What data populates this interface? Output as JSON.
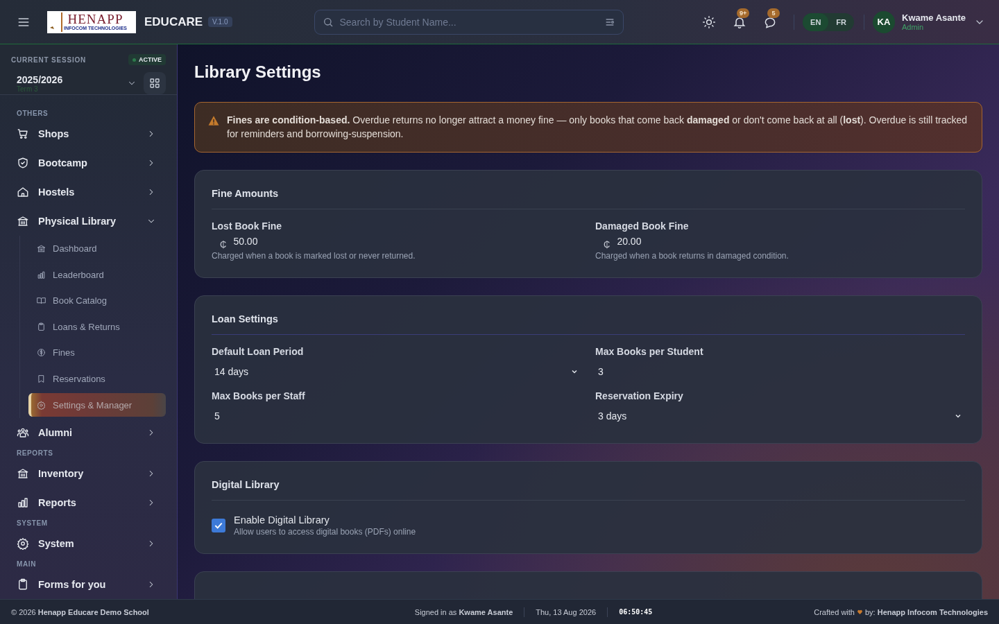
{
  "header": {
    "logo": {
      "line1": "HENAPP",
      "line2": "INFOCOM TECHNOLOGIES"
    },
    "app_name": "EDUCARE",
    "version": "V.1.0",
    "search": {
      "placeholder": "Search by Student Name..."
    },
    "notifications_badge": "9+",
    "messages_badge": "5",
    "languages": [
      {
        "label": "EN",
        "selected": true
      },
      {
        "label": "FR",
        "selected": false
      }
    ],
    "user": {
      "initials": "KA",
      "name": "Kwame Asante",
      "role": "Admin"
    }
  },
  "session": {
    "label": "CURRENT SESSION",
    "status": "ACTIVE",
    "year": "2025/2026",
    "term": "Term 3"
  },
  "sidebar": {
    "items": [
      {
        "kind": "section",
        "label": "OTHERS"
      },
      {
        "kind": "item",
        "label": "Shops",
        "expanded": false
      },
      {
        "kind": "item",
        "label": "Bootcamp",
        "expanded": false
      },
      {
        "kind": "item",
        "label": "Hostels",
        "expanded": false
      },
      {
        "kind": "item",
        "label": "Physical Library",
        "expanded": true,
        "children": [
          {
            "label": "Dashboard",
            "selected": false
          },
          {
            "label": "Leaderboard",
            "selected": false
          },
          {
            "label": "Book Catalog",
            "selected": false
          },
          {
            "label": "Loans & Returns",
            "selected": false
          },
          {
            "label": "Fines",
            "selected": false
          },
          {
            "label": "Reservations",
            "selected": false
          },
          {
            "label": "Settings & Manager",
            "selected": true
          }
        ]
      },
      {
        "kind": "item",
        "label": "Alumni",
        "expanded": false
      },
      {
        "kind": "section",
        "label": "REPORTS"
      },
      {
        "kind": "item",
        "label": "Inventory",
        "expanded": false
      },
      {
        "kind": "item",
        "label": "Reports",
        "expanded": false
      },
      {
        "kind": "section",
        "label": "SYSTEM"
      },
      {
        "kind": "item",
        "label": "System",
        "expanded": false
      },
      {
        "kind": "section",
        "label": "MAIN"
      },
      {
        "kind": "item",
        "label": "Forms for you",
        "expanded": false
      }
    ]
  },
  "page": {
    "title": "Library Settings",
    "alert": "**Fines are condition-based.** Overdue returns no longer attract a money fine — only books that come back **damaged** or don't come back at all (**lost**). Overdue is still tracked for reminders and borrowing-suspension.",
    "fine_amounts": {
      "title": "Fine Amounts",
      "fields": [
        {
          "label": "Lost Book Fine",
          "currency": "₵",
          "value": "50.00",
          "help": "Charged when a book is marked lost or never returned."
        },
        {
          "label": "Damaged Book Fine",
          "currency": "₵",
          "value": "20.00",
          "help": "Charged when a book returns in damaged condition."
        }
      ]
    },
    "loan_settings": {
      "title": "Loan Settings",
      "fields": [
        {
          "label": "Default Loan Period",
          "kind": "select",
          "value": "14 days"
        },
        {
          "label": "Max Books per Student",
          "kind": "input",
          "value": "3"
        },
        {
          "label": "Max Books per Staff",
          "kind": "input",
          "value": "5"
        },
        {
          "label": "Reservation Expiry",
          "kind": "select",
          "value": "3 days"
        }
      ]
    },
    "digital_library": {
      "title": "Digital Library",
      "checkbox": {
        "label": "Enable Digital Library",
        "description": "Allow users to access digital books (PDFs) online",
        "checked": true
      }
    }
  },
  "footer": {
    "copyright": "© 2026 **Henapp Educare Demo School**",
    "signed_in": "Signed in as **Kwame Asante**",
    "date": "Thu, 13 Aug 2026",
    "time": "06:50:45",
    "credit": "Crafted with",
    "credit_by": "by: **Henapp Infocom Technologies**"
  }
}
